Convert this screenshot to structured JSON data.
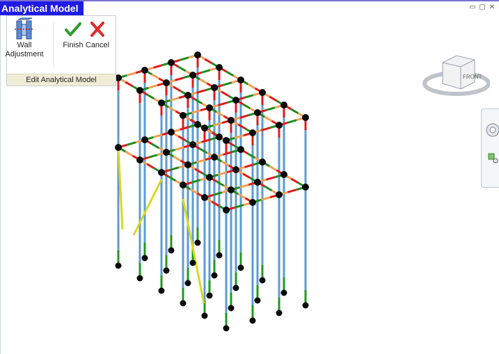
{
  "window": {
    "title": "Analytical Model",
    "controls": {
      "minimize": "▭",
      "restore": "▢",
      "close": "✕"
    }
  },
  "ribbon": {
    "buttons": {
      "wall_adjustment": {
        "line1": "Wall",
        "line2": "Adjustment",
        "icon": "wall-adjustment-icon"
      },
      "finish": {
        "label": "Finish",
        "icon": "checkmark-icon"
      },
      "cancel": {
        "label": "Cancel",
        "icon": "x-icon"
      }
    },
    "panel_label": "Edit Analytical Model"
  },
  "viewcube": {
    "face_label": "FRONT"
  },
  "colors": {
    "title_bg": "#1f1ae6",
    "column": "#5b9bd5",
    "column_end": "#1e9b1e",
    "beam_a": "#f0a050",
    "beam_b": "#e01a1a",
    "beam_c": "#1e8c1e",
    "brace": "#d8d820",
    "node": "#0a0a0a"
  }
}
